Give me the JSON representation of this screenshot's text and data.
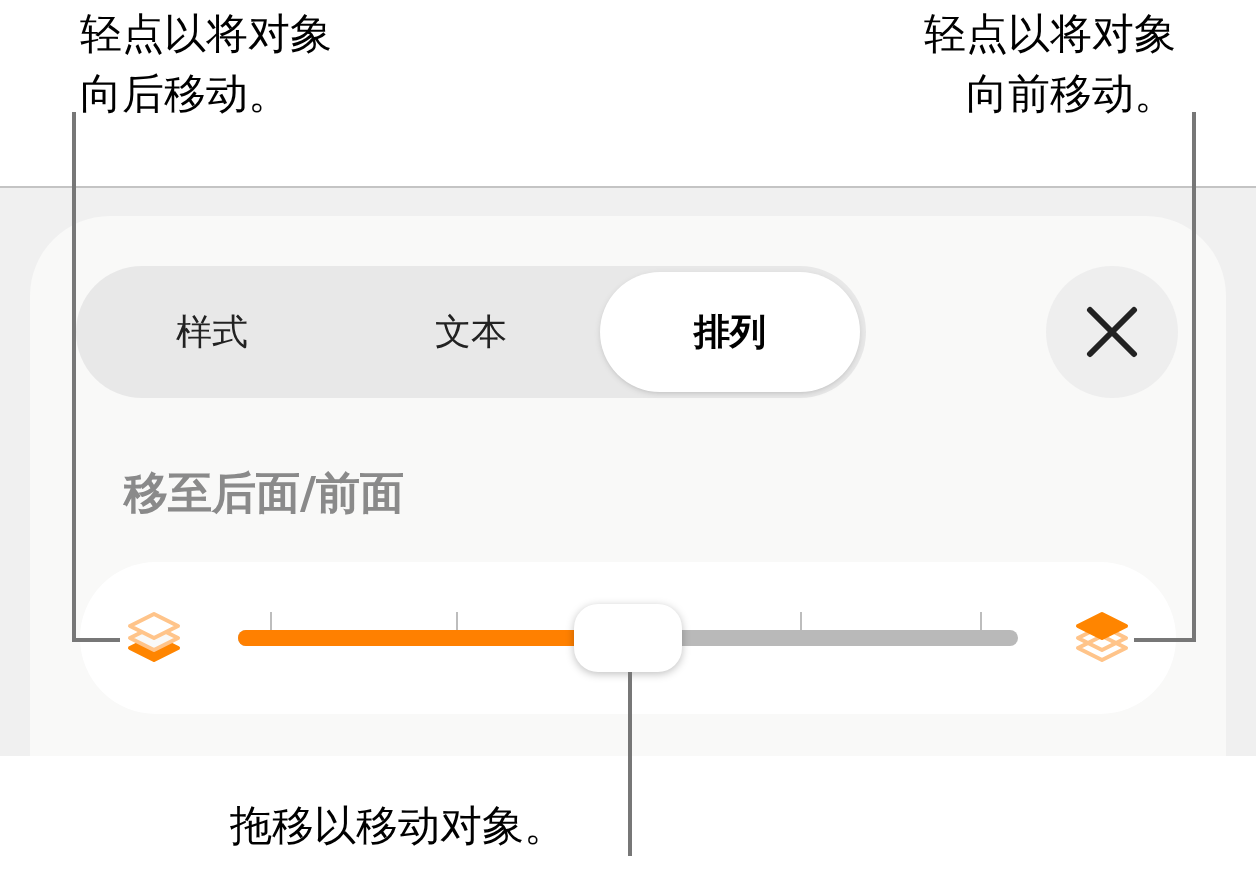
{
  "callouts": [
    {
      "text": "轻点以将对象向后移动。"
    },
    {
      "text": "轻点以将对象向前移动。"
    },
    {
      "text": "拖移以移动对象。"
    }
  ],
  "tabs": [
    {
      "label": "样式",
      "selected": false
    },
    {
      "label": "文本",
      "selected": false
    },
    {
      "label": "排列",
      "selected": true
    }
  ],
  "section_title": "移至后面/前面",
  "slider": {
    "level": 0.5
  }
}
